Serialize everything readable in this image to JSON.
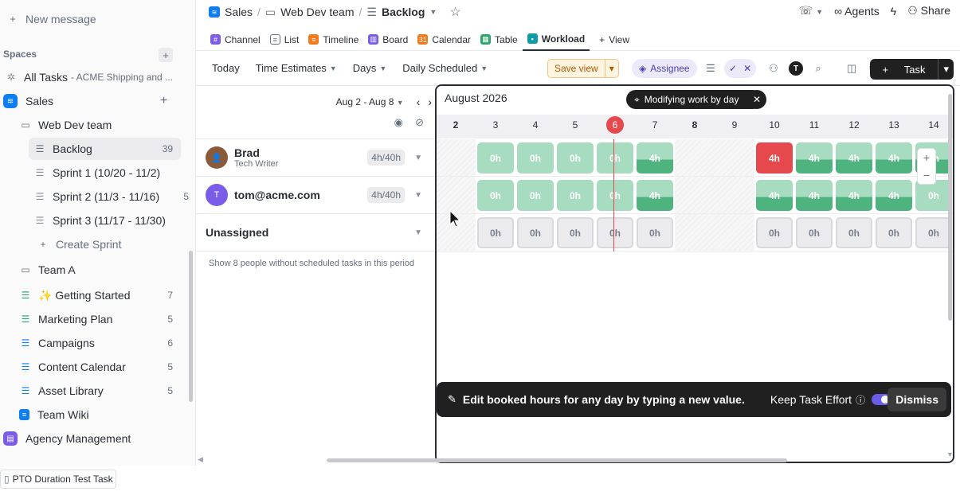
{
  "sidebar": {
    "new_message": "New message",
    "spaces_label": "Spaces",
    "all_tasks": "All Tasks",
    "all_tasks_sub": "- ACME Shipping and ...",
    "sales": "Sales",
    "web_dev_team": "Web Dev team",
    "backlog": "Backlog",
    "backlog_count": "39",
    "sprint1": "Sprint 1 (10/20 - 11/2)",
    "sprint2": "Sprint 2 (11/3 - 11/16)",
    "sprint2_count": "5",
    "sprint3": "Sprint 3 (11/17 - 11/30)",
    "create_sprint": "Create Sprint",
    "team_a": "Team A",
    "getting_started": "✨ Getting Started",
    "getting_started_count": "7",
    "marketing_plan": "Marketing Plan",
    "marketing_plan_count": "5",
    "campaigns": "Campaigns",
    "campaigns_count": "6",
    "content_calendar": "Content Calendar",
    "content_calendar_count": "5",
    "asset_library": "Asset Library",
    "asset_library_count": "5",
    "team_wiki": "Team Wiki",
    "agency_management": "Agency Management"
  },
  "breadcrumb": {
    "space": "Sales",
    "folder": "Web Dev team",
    "list": "Backlog"
  },
  "top": {
    "agents": "Agents",
    "share": "Share"
  },
  "tabs": [
    "Channel",
    "List",
    "Timeline",
    "Board",
    "Calendar",
    "Table",
    "Workload",
    "View"
  ],
  "toolbar": {
    "today": "Today",
    "time_estimates": "Time Estimates",
    "days": "Days",
    "daily_scheduled": "Daily Scheduled",
    "save_view": "Save view",
    "assignee": "Assignee",
    "task": "Task"
  },
  "workload": {
    "range": "Aug 2 - Aug 8",
    "month": "August 2026",
    "modifying": "Modifying work by day",
    "hidden_note": "Show 8 people without scheduled tasks in this period",
    "today": "6",
    "days": [
      "2",
      "3",
      "4",
      "5",
      "6",
      "7",
      "8",
      "9",
      "10",
      "11",
      "12",
      "13",
      "14"
    ],
    "bold_days": [
      "2",
      "8"
    ],
    "weekend_days": [
      "2",
      "8",
      "9"
    ],
    "rows": [
      {
        "cells": [
          "",
          "0h",
          "0h",
          "0h",
          "0h",
          "4h",
          "",
          "",
          "4h",
          "4h",
          "4h",
          "4h",
          "4h"
        ],
        "types": [
          "hatch",
          "light",
          "light",
          "light",
          "light",
          "half",
          "hatch",
          "hatch",
          "red",
          "half",
          "half",
          "half",
          "half"
        ]
      },
      {
        "cells": [
          "",
          "0h",
          "0h",
          "0h",
          "0h",
          "4h",
          "",
          "",
          "4h",
          "4h",
          "4h",
          "4h",
          "0h"
        ],
        "types": [
          "hatch",
          "light",
          "light",
          "light",
          "light",
          "half",
          "hatch",
          "hatch",
          "half",
          "half",
          "half",
          "half",
          "light"
        ]
      },
      {
        "cells": [
          "",
          "0h",
          "0h",
          "0h",
          "0h",
          "0h",
          "",
          "",
          "0h",
          "0h",
          "0h",
          "0h",
          "0h"
        ],
        "types": [
          "hatch",
          "empty",
          "empty",
          "empty",
          "empty",
          "empty",
          "hatch",
          "hatch",
          "empty",
          "empty",
          "empty",
          "empty",
          "empty"
        ]
      }
    ]
  },
  "people": [
    {
      "name": "Brad",
      "role": "Tech Writer",
      "total": "4h/40h"
    },
    {
      "name": "tom@acme.com",
      "initial": "T",
      "total": "4h/40h"
    },
    {
      "name": "Unassigned"
    }
  ],
  "banner": {
    "text": "Edit booked hours for any day by typing a new value.",
    "keep_label": "Keep Task Effort",
    "dismiss": "Dismiss"
  },
  "bottom": {
    "doc": "PTO Duration Test Task"
  },
  "colors": {
    "accent": "#7b5ce7",
    "today": "#e5484d",
    "capacity_light": "#a7dcc0",
    "capacity_dark": "#4fb37f"
  }
}
